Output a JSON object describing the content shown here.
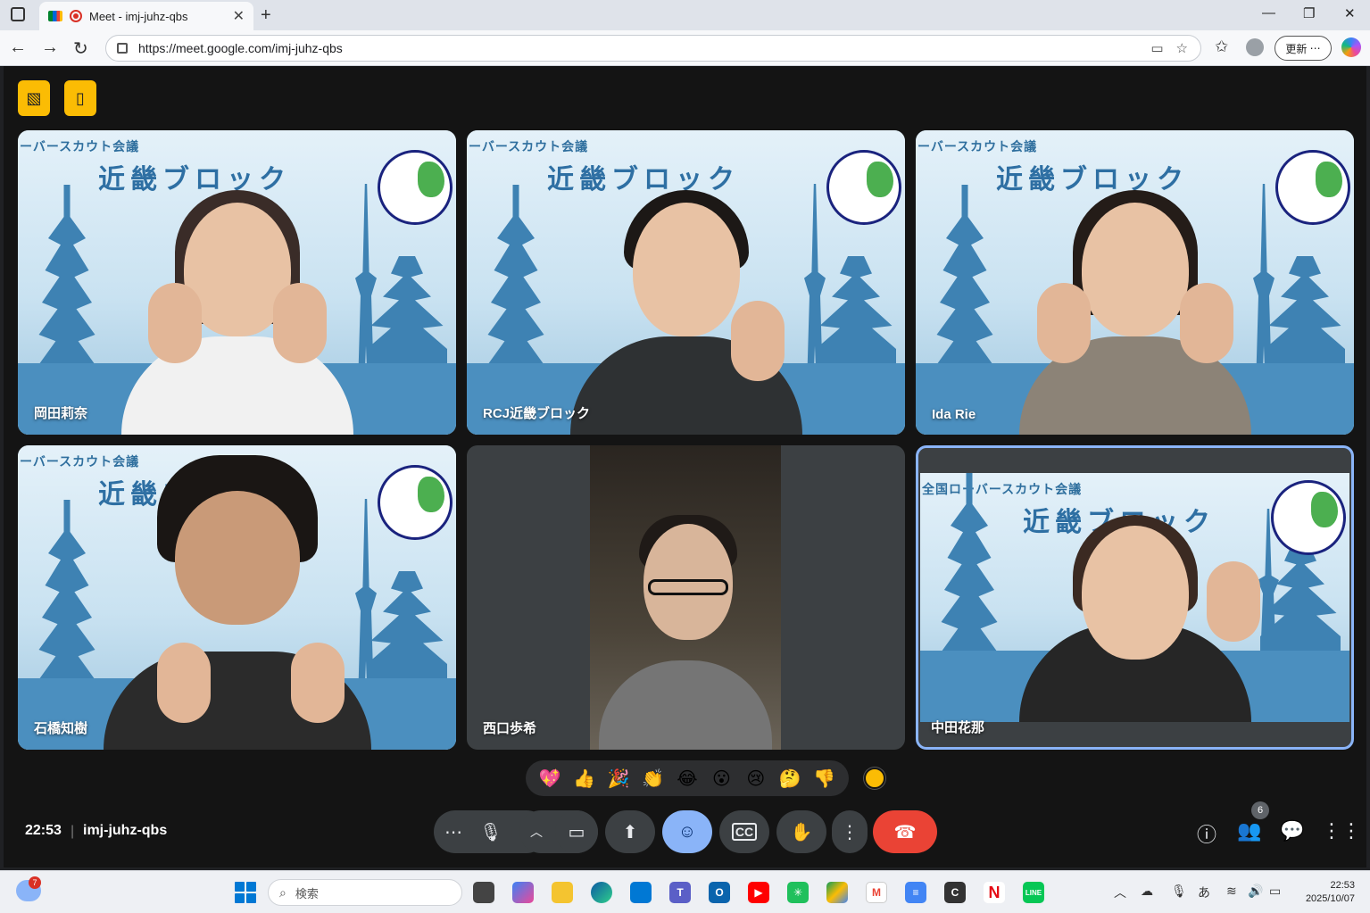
{
  "browser": {
    "tab_title": "Meet - imj-juhz-qbs",
    "url": "https://meet.google.com/imj-juhz-qbs",
    "update_label": "更新"
  },
  "meeting": {
    "time": "22:53",
    "code": "imj-juhz-qbs",
    "participant_count": "6"
  },
  "background": {
    "banner_text": "ーバースカウト会議",
    "block_text": "近畿ブロック",
    "banner_text_full": "全国ローバースカウト会議"
  },
  "participants": [
    {
      "name": "岡田莉奈"
    },
    {
      "name": "RCJ近畿ブロック"
    },
    {
      "name": "Ida Rie"
    },
    {
      "name": "石橋知樹"
    },
    {
      "name": "西口歩希"
    },
    {
      "name": "中田花那"
    }
  ],
  "reactions": [
    "💖",
    "👍",
    "🎉",
    "👏",
    "😂",
    "😮",
    "😢",
    "🤔",
    "👎"
  ],
  "taskbar": {
    "search_placeholder": "検索",
    "weather_badge": "7",
    "clock_time": "22:53",
    "clock_date": "2025/10/07",
    "ime": "あ"
  },
  "colors": {
    "meet_bg": "#141414",
    "tile_dark": "#3c4043",
    "accent_blue": "#8ab4f8",
    "end_call_red": "#ea4335",
    "yellow": "#fbbc04"
  }
}
